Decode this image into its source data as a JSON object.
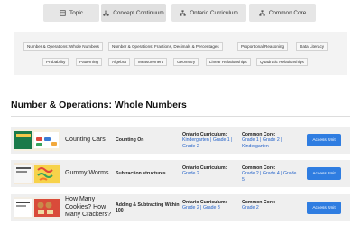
{
  "tabs": [
    {
      "label": "Topic",
      "icon": "grid-icon"
    },
    {
      "label": "Concept Continuum",
      "icon": "network-icon"
    },
    {
      "label": "Ontario Curriculum",
      "icon": "hierarchy-icon"
    },
    {
      "label": "Common Core",
      "icon": "hierarchy-icon"
    }
  ],
  "filters": [
    "Number & Operations: Whole Numbers",
    "Number & Operations: Fractions, Decimals & Percentages",
    "Proportional Reasoning",
    "Data Literacy",
    "Probability",
    "Patterning",
    "Algebra",
    "Measurement",
    "Geometry",
    "Linear Relationships",
    "Quadratic Relationships"
  ],
  "section": {
    "title": "Number & Operations: Whole Numbers"
  },
  "column_labels": {
    "ontario": "Ontario Curriculum:",
    "common_core": "Common Core:"
  },
  "rows": [
    {
      "title": "Counting Cars",
      "concept": "Counting On",
      "ontario_line1": "Kindergarten | Grade 1 |",
      "ontario_line2": "Grade 2",
      "cc_line1": "Grade 1 | Grade 2 |",
      "cc_line2": "Kindergarten",
      "button": "Access Unit"
    },
    {
      "title": "Gummy Worms",
      "concept": "Subtraction structures",
      "ontario_line1": "Grade 2",
      "ontario_line2": "",
      "cc_line1": "Grade 2 | Grade 4 | Grade",
      "cc_line2": "5",
      "button": "Access Unit"
    },
    {
      "title": "How Many Cookies? How Many Crackers?",
      "concept": "Adding & Subtracting Within 100",
      "ontario_line1": "Grade 2 | Grade 3",
      "ontario_line2": "",
      "cc_line1": "Grade 2",
      "cc_line2": "",
      "button": "Access Unit"
    }
  ],
  "colors": {
    "link": "#2563c9",
    "button": "#2f7de1",
    "row_bg": "#efefef",
    "tab_bg": "#e6e6e6"
  }
}
